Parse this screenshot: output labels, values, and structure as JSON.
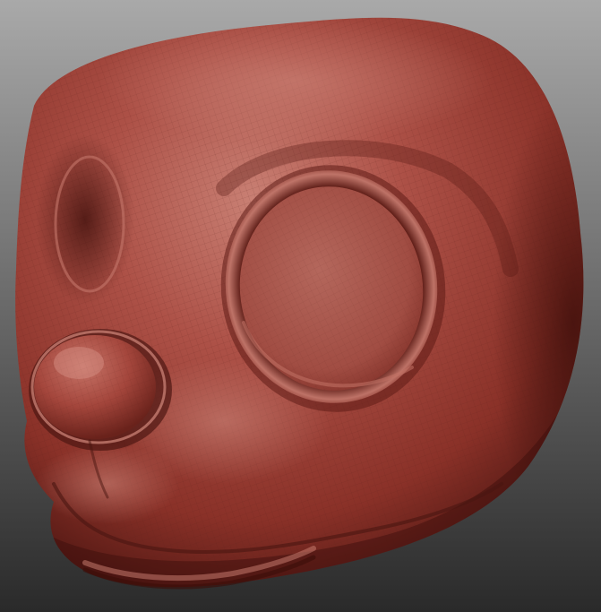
{
  "viewport": {
    "background_top": "#a9a9a9",
    "background_bottom": "#2a2a2a"
  },
  "model": {
    "subject": "head-sculpt",
    "material_colors": {
      "base": "#a3453b",
      "highlight": "#c97a6e",
      "shadow": "#4d1712",
      "deep_shadow": "#2f0c09",
      "wire": "#6e2a23"
    },
    "wireframe": true
  }
}
